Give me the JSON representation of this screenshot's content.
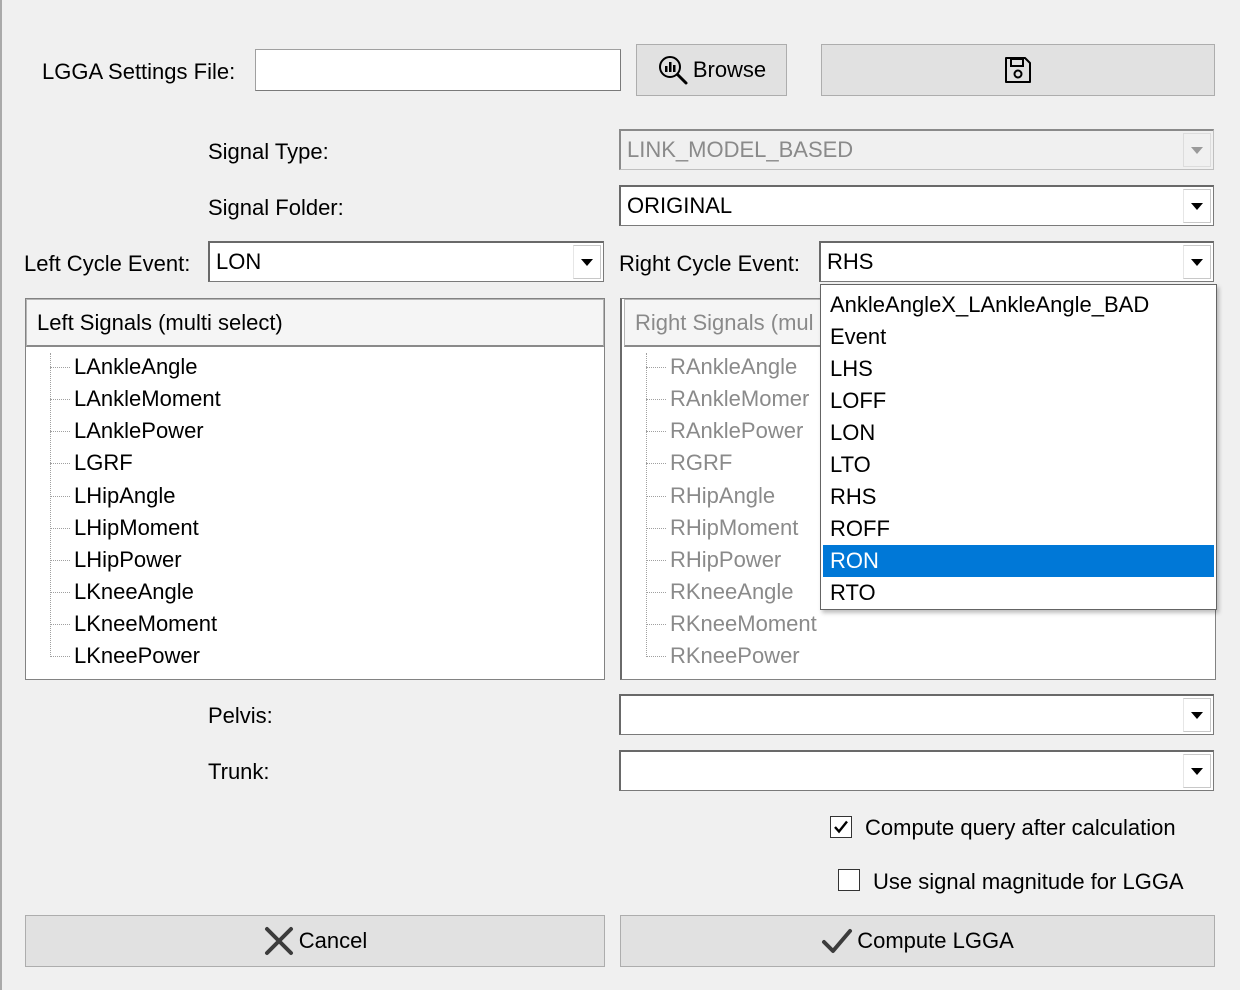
{
  "settings": {
    "label": "LGGA Settings File:",
    "value": "",
    "browse_label": "Browse"
  },
  "signal_type": {
    "label": "Signal Type:",
    "value": "LINK_MODEL_BASED"
  },
  "signal_folder": {
    "label": "Signal Folder:",
    "value": "ORIGINAL"
  },
  "left_cycle": {
    "label": "Left Cycle Event:",
    "value": "LON"
  },
  "right_cycle": {
    "label": "Right Cycle Event:",
    "value": "RHS",
    "options": [
      "AnkleAngleX_LAnkleAngle_BAD",
      "Event",
      "LHS",
      "LOFF",
      "LON",
      "LTO",
      "RHS",
      "ROFF",
      "RON",
      "RTO"
    ],
    "highlighted": "RON"
  },
  "left_signals": {
    "header": "Left Signals (multi select)",
    "items": [
      "LAnkleAngle",
      "LAnkleMoment",
      "LAnklePower",
      "LGRF",
      "LHipAngle",
      "LHipMoment",
      "LHipPower",
      "LKneeAngle",
      "LKneeMoment",
      "LKneePower"
    ]
  },
  "right_signals": {
    "header": "Right Signals (mul",
    "items": [
      "RAnkleAngle",
      "RAnkleMomer",
      "RAnklePower",
      "RGRF",
      "RHipAngle",
      "RHipMoment",
      "RHipPower",
      "RKneeAngle",
      "RKneeMoment",
      "RKneePower"
    ]
  },
  "pelvis": {
    "label": "Pelvis:",
    "value": ""
  },
  "trunk": {
    "label": "Trunk:",
    "value": ""
  },
  "options": {
    "compute_query_label": "Compute query after calculation",
    "compute_query_checked": true,
    "use_magnitude_label": "Use signal magnitude for LGGA",
    "use_magnitude_checked": false
  },
  "actions": {
    "cancel_label": "Cancel",
    "compute_label": "Compute LGGA"
  },
  "colors": {
    "highlight": "#0078d7",
    "disabled_text": "#8a8a8a"
  }
}
